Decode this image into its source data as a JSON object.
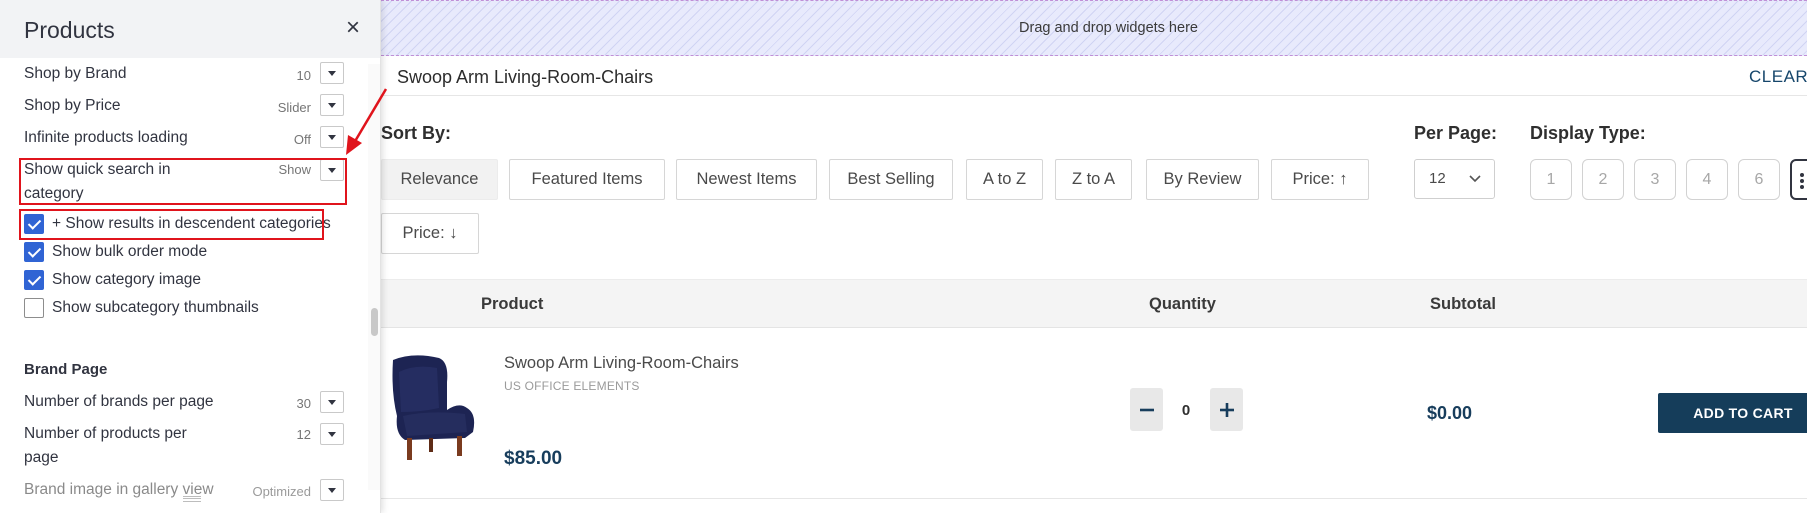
{
  "panel": {
    "title": "Products",
    "close_icon": "close-icon",
    "settings": [
      {
        "label": "Shop by Brand",
        "value": "10"
      },
      {
        "label": "Shop by Price",
        "value": "Slider"
      },
      {
        "label": "Infinite products loading",
        "value": "Off"
      },
      {
        "label_line1": "Show quick search in",
        "label_line2": "category",
        "value": "Show"
      }
    ],
    "checkboxes": [
      {
        "label": "+ Show results in descendent categories",
        "checked": true
      },
      {
        "label": "Show bulk order mode",
        "checked": true
      },
      {
        "label": "Show category image",
        "checked": true
      },
      {
        "label": "Show subcategory thumbnails",
        "checked": false
      }
    ],
    "brand_section": {
      "title": "Brand Page",
      "settings": [
        {
          "label": "Number of brands per page",
          "value": "30"
        },
        {
          "label_line1": "Number of products per",
          "label_line2": "page",
          "value": "12"
        },
        {
          "label": "Brand image in gallery view",
          "value": "Optimized"
        }
      ]
    },
    "highlight_color": "#e0141c"
  },
  "dropzone": {
    "text": "Drag and drop widgets here"
  },
  "header": {
    "title": "Swoop Arm Living-Room-Chairs",
    "clear_all": "CLEAR ALL"
  },
  "sort": {
    "label": "Sort By:",
    "options": [
      "Relevance",
      "Featured Items",
      "Newest Items",
      "Best Selling",
      "A to Z",
      "Z to A",
      "By Review",
      "Price: ↑",
      "Price: ↓"
    ],
    "active": "Relevance"
  },
  "per_page": {
    "label": "Per Page:",
    "value": "12"
  },
  "display_type": {
    "label": "Display Type:",
    "options": [
      "1",
      "2",
      "3",
      "4",
      "6"
    ]
  },
  "table": {
    "headers": {
      "product": "Product",
      "quantity": "Quantity",
      "subtotal": "Subtotal"
    }
  },
  "product": {
    "name": "Swoop Arm Living-Room-Chairs",
    "brand": "US OFFICE ELEMENTS",
    "price": "$85.00",
    "quantity": "0",
    "subtotal": "$0.00",
    "add_to_cart": "ADD TO CART",
    "image_icon": "armchair-image"
  },
  "colors": {
    "accent": "#153d5a",
    "checkbox": "#3064d4"
  }
}
